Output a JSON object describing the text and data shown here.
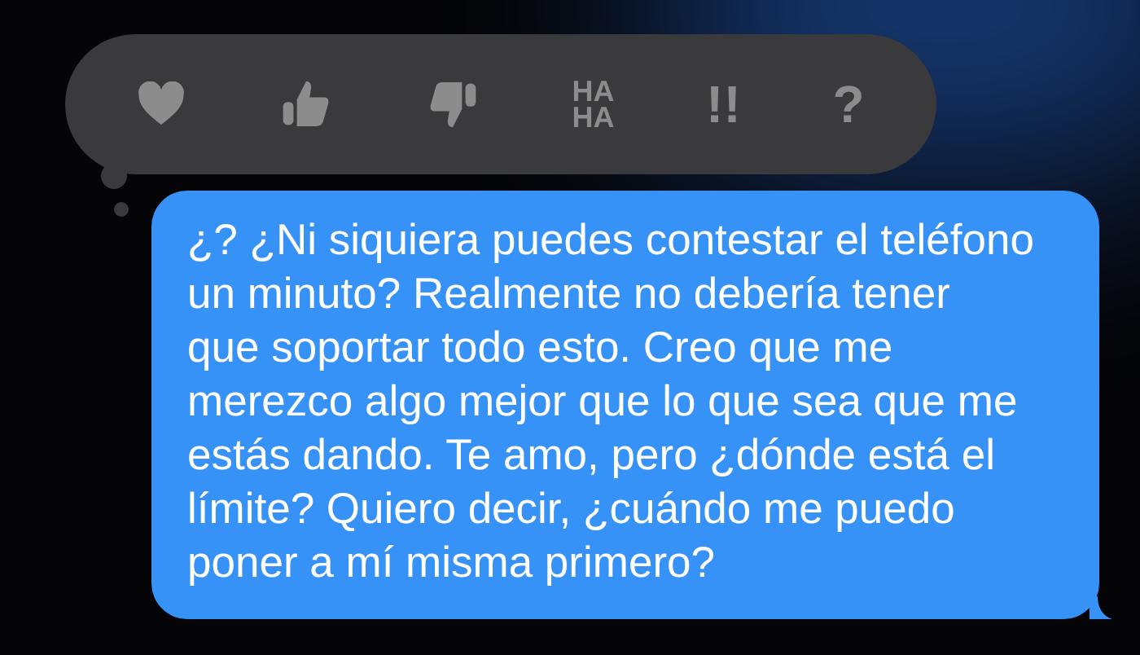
{
  "tapback_bar": {
    "text_reactions": [
      "HA HA",
      "!!",
      "?"
    ]
  },
  "message": {
    "lines": [
      "¿? ¿Ni siquiera puedes contestar el teléfono",
      "un minuto? Realmente no debería tener",
      "que soportar todo esto. Creo que me",
      "merezco algo mejor que lo que sea que me",
      "estás dando. Te amo, pero ¿dónde está el",
      "límite? Quiero decir, ¿cuándo me puedo",
      "poner a mí misma primero?"
    ]
  }
}
